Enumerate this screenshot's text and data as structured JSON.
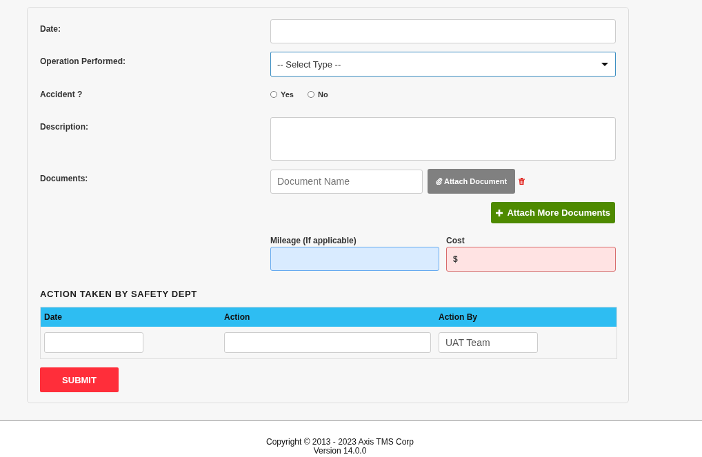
{
  "form": {
    "date_label": "Date:",
    "operation_label": "Operation Performed:",
    "operation_value": "-- Select Type --",
    "accident_label": "Accident ?",
    "accident_options": [
      {
        "label": "Yes",
        "selected": false
      },
      {
        "label": "No",
        "selected": false
      }
    ],
    "description_label": "Description:",
    "documents_label": "Documents:",
    "document_name_placeholder": "Document Name",
    "attach_button": "Attach Document",
    "attach_more_button": "Attach More Documents",
    "mileage_label": "Mileage (If applicable)",
    "cost_label": "Cost",
    "cost_prefix": "$"
  },
  "action_section": {
    "title": "ACTION TAKEN BY SAFETY DEPT",
    "columns": [
      "Date",
      "Action",
      "Action By"
    ],
    "action_by_value": "UAT Team"
  },
  "submit_button": "SUBMIT",
  "footer": {
    "copyright": "Copyright © 2013 - 2023 Axis TMS Corp",
    "version": "Version 14.0.0"
  }
}
